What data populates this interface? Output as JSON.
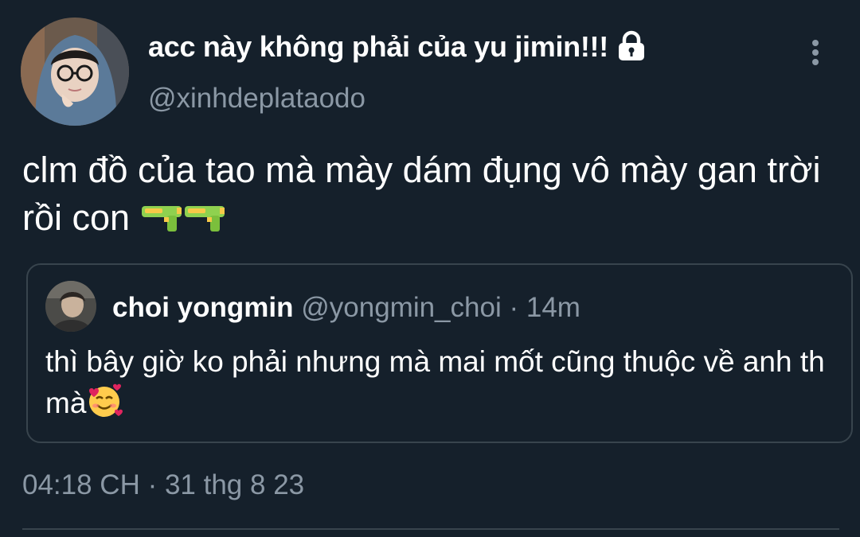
{
  "author": {
    "display_name": "acc này không phải của yu jimin!!!",
    "handle": "@xinhdeplataodo",
    "badge_icon": "lock-icon"
  },
  "tweet": {
    "text": "clm đồ của tao mà mày dám đụng vô mày gan trời rồi con",
    "emojis": [
      "water-pistol-icon",
      "water-pistol-icon"
    ],
    "timestamp": "04:18 CH · 31 thg 8 23"
  },
  "quoted_tweet": {
    "display_name": "choi yongmin",
    "handle": "@yongmin_choi",
    "separator": "·",
    "time": "14m",
    "text": "thì bây giờ ko phải nhưng mà mai mốt cũng thuộc về anh th mà",
    "emoji": "smiling-face-with-hearts-icon"
  },
  "colors": {
    "background": "#15202b",
    "secondary_text": "#8b98a5",
    "border": "#38444d"
  }
}
